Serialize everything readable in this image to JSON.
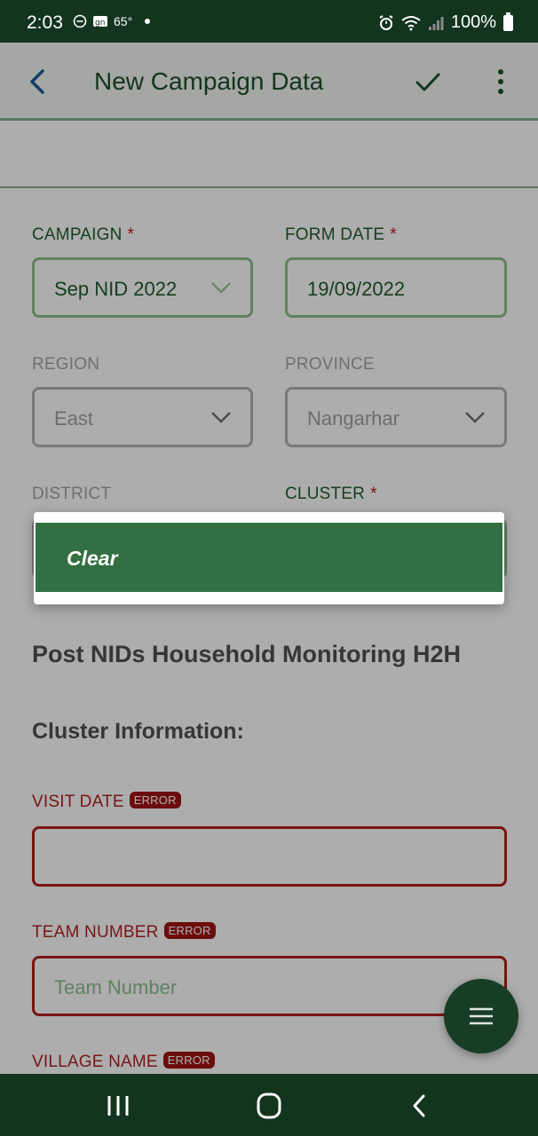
{
  "status_bar": {
    "time": "2:03",
    "temperature": "65°",
    "battery": "100%"
  },
  "app_bar": {
    "title": "New Campaign Data"
  },
  "form": {
    "campaign": {
      "label": "CAMPAIGN",
      "required_mark": "*",
      "value": "Sep NID 2022"
    },
    "form_date": {
      "label": "FORM DATE",
      "required_mark": "*",
      "value": "19/09/2022"
    },
    "region": {
      "label": "REGION",
      "value": "East"
    },
    "province": {
      "label": "PROVINCE",
      "value": "Nangarhar"
    },
    "district": {
      "label": "DISTRICT"
    },
    "cluster": {
      "label": "CLUSTER",
      "required_mark": "*"
    },
    "section_title": "Post NIDs Household Monitoring H2H",
    "section_subtitle": "Cluster Information:",
    "visit_date": {
      "label": "VISIT DATE",
      "badge": "ERROR",
      "value": ""
    },
    "team_number": {
      "label": "TEAM NUMBER",
      "badge": "ERROR",
      "placeholder": "Team Number"
    },
    "village_name": {
      "label": "VILLAGE NAME",
      "badge": "ERROR"
    }
  },
  "popup_menu": {
    "items": [
      {
        "label": "Clear"
      }
    ]
  },
  "fab": {
    "icon": "menu-icon"
  },
  "nav_bar": {
    "icons": [
      "recents-icon",
      "home-icon",
      "back-icon"
    ]
  },
  "colors": {
    "primary_dark": "#13341d",
    "primary": "#336f42",
    "label_green": "#1e5c2b",
    "error_red": "#b22222"
  }
}
